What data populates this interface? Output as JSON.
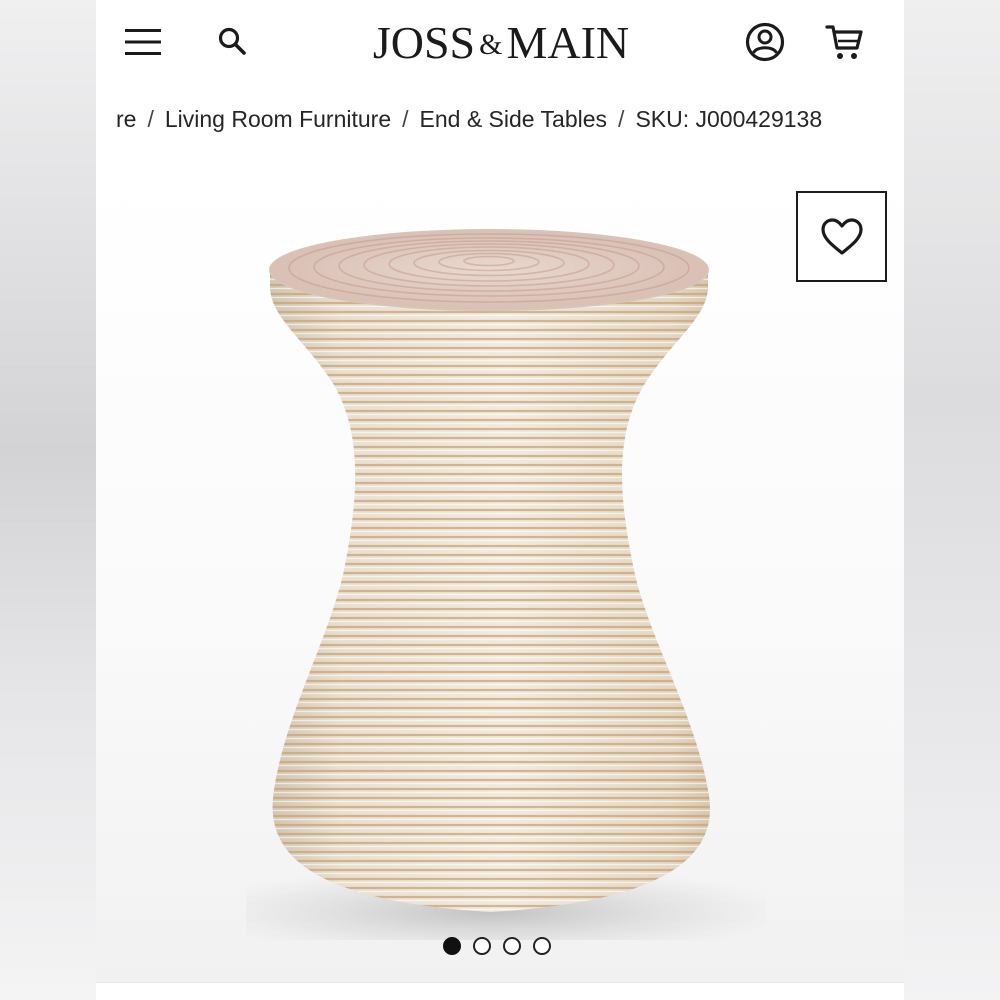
{
  "header": {
    "logo_left": "JOSS",
    "logo_amp": "&",
    "logo_right": "MAIN",
    "icons": {
      "menu": "hamburger-menu-icon",
      "search": "search-icon",
      "account": "account-icon",
      "cart": "cart-icon"
    }
  },
  "breadcrumb": {
    "items": [
      "re",
      "Living Room Furniture",
      "End & Side Tables"
    ],
    "separator": "/",
    "sku": "SKU: J000429138"
  },
  "product": {
    "favorite_icon": "heart-icon",
    "image": "hourglass-rattan-side-table",
    "carousel": {
      "count": 4,
      "active_index": 0
    }
  },
  "colors": {
    "text": "#1b1b1b",
    "background": "#ffffff"
  }
}
